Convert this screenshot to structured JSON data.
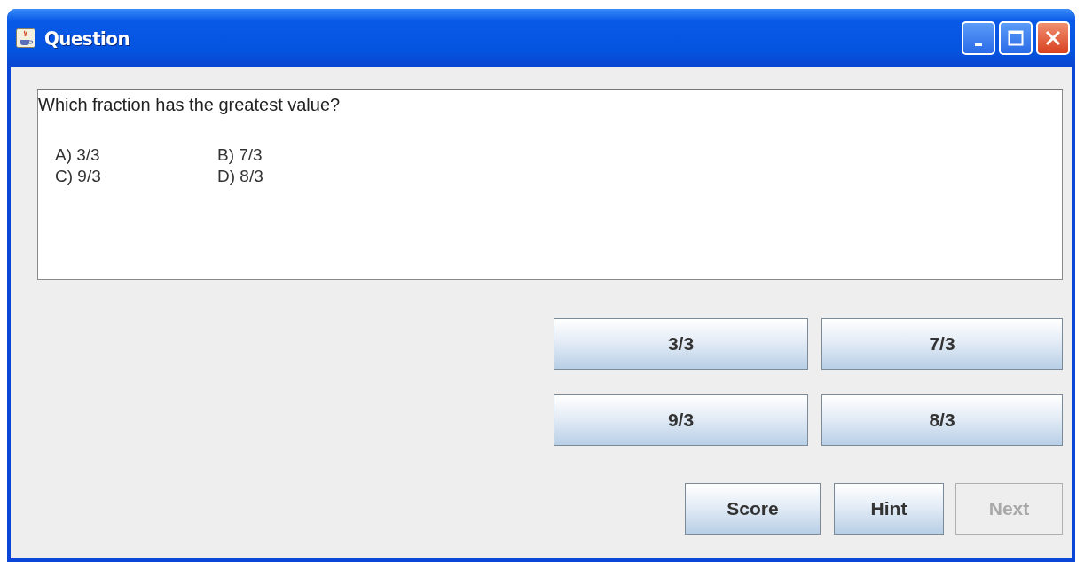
{
  "window": {
    "title": "Question"
  },
  "question": {
    "text": "Which fraction has the greatest value?",
    "choices": [
      "A) 3/3",
      "B) 7/3",
      "C) 9/3",
      "D) 8/3"
    ]
  },
  "answer_buttons": [
    {
      "label": "3/3",
      "disabled": false
    },
    {
      "label": "7/3",
      "disabled": false
    },
    {
      "label": "9/3",
      "disabled": false
    },
    {
      "label": "8/3",
      "disabled": false
    }
  ],
  "buttons": [
    {
      "label": "Score",
      "disabled": false
    },
    {
      "label": "Hint",
      "disabled": false
    },
    {
      "label": "Next",
      "disabled": true
    }
  ]
}
